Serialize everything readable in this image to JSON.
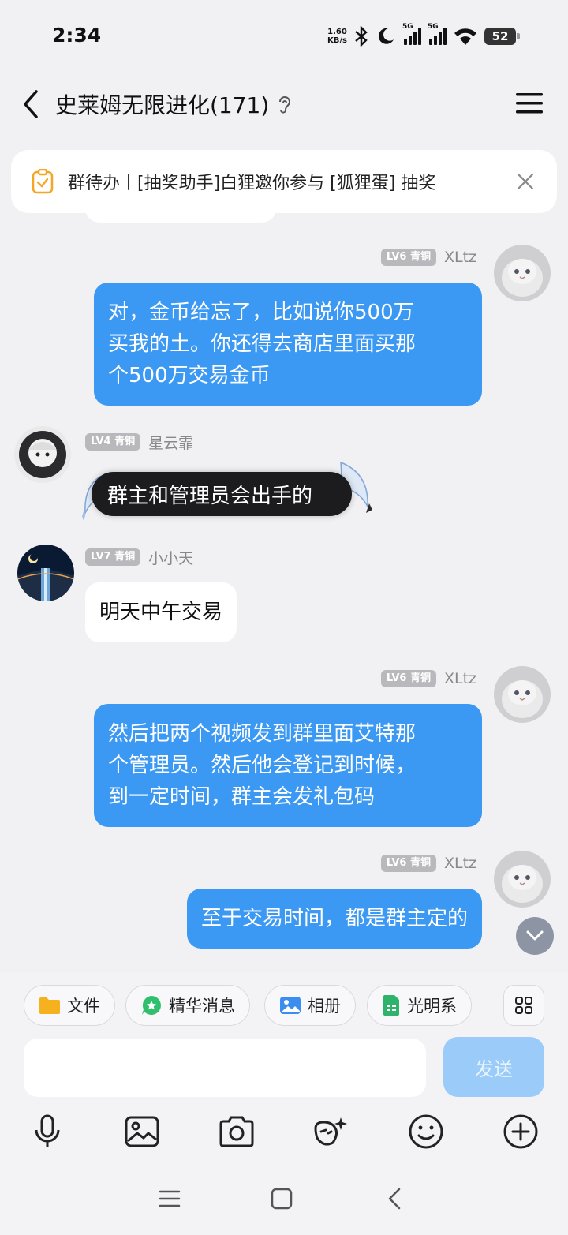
{
  "status_bar": {
    "time": "2:34",
    "net_speed_value": "1.60",
    "net_speed_unit": "KB/s",
    "signal_1": "5G",
    "signal_2": "5G",
    "battery": "52"
  },
  "header": {
    "title": "史莱姆无限进化(171)"
  },
  "todo": {
    "text": "群待办丨[抽奖助手]白狸邀你参与 [狐狸蛋] 抽奖"
  },
  "messages": [
    {
      "level": "LV6 青铜",
      "nickname": "XLtz",
      "lines": [
        "对，金币给忘了，比如说你500万",
        "买我的土。你还得去商店里面买那",
        "个500万交易金币"
      ],
      "direction": "outgoing"
    },
    {
      "level": "LV4 青铜",
      "nickname": "星云霏",
      "text": "群主和管理员会出手的",
      "direction": "incoming"
    },
    {
      "level": "LV7 青铜",
      "nickname": "小小天",
      "text": "明天中午交易",
      "direction": "incoming"
    },
    {
      "level": "LV6 青铜",
      "nickname": "XLtz",
      "lines": [
        "然后把两个视频发到群里面艾特那",
        "个管理员。然后他会登记到时候，",
        "到一定时间，群主会发礼包码"
      ],
      "direction": "outgoing"
    },
    {
      "level": "LV6 青铜",
      "nickname": "XLtz",
      "text": "至于交易时间，都是群主定的",
      "direction": "outgoing"
    }
  ],
  "quick_actions": [
    {
      "label": "文件",
      "icon": "folder-icon"
    },
    {
      "label": "精华消息",
      "icon": "star-chat-icon"
    },
    {
      "label": "相册",
      "icon": "photo-album-icon"
    },
    {
      "label": "光明系",
      "icon": "document-icon"
    }
  ],
  "composer": {
    "input_value": "",
    "send_label": "发送"
  },
  "colors": {
    "outgoing_bubble": "#3b98f3",
    "incoming_bubble": "#ffffff",
    "send_disabled": "#9bcbf9",
    "background": "#f1f1f3"
  }
}
